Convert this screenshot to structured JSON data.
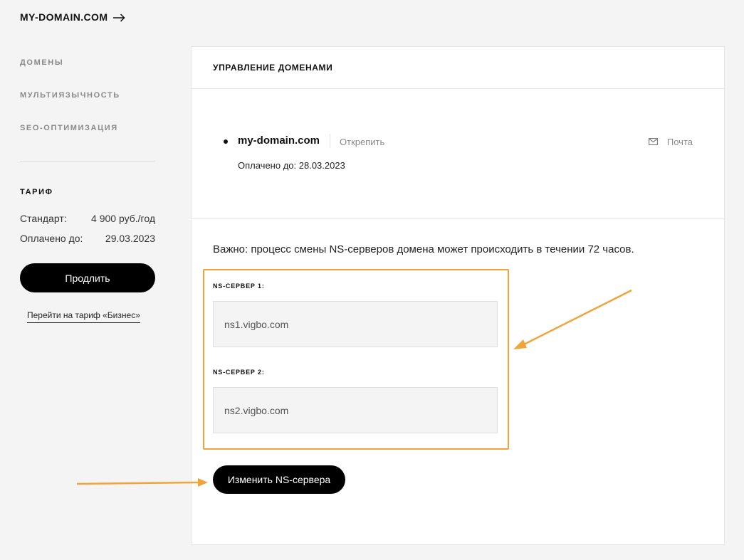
{
  "header": {
    "site_link_label": "MY-DOMAIN.COM",
    "site_link_icon": "arrow-right-icon"
  },
  "sidebar": {
    "nav_items": [
      {
        "label": "ДОМЕНЫ"
      },
      {
        "label": "МУЛЬТИЯЗЫЧНОСТЬ"
      },
      {
        "label": "SEO-ОПТИМИЗАЦИЯ"
      }
    ],
    "tariff": {
      "title": "ТАРИФ",
      "plan_label": "Стандарт:",
      "plan_price": "4 900 руб./год",
      "paid_label": "Оплачено до:",
      "paid_date": "29.03.2023",
      "renew_button": "Продлить",
      "switch_link": "Перейти на тариф «Бизнес»"
    }
  },
  "main": {
    "title": "УПРАВЛЕНИЕ ДОМЕНАМИ",
    "domain": {
      "name": "my-domain.com",
      "unpin_label": "Открепить",
      "mail_label": "Почта",
      "mail_icon": "envelope-icon",
      "paid_until": "Оплачено до: 28.03.2023"
    },
    "ns": {
      "warning": "Важно: процесс смены NS-серверов домена может происходить в течении 72 часов.",
      "server1_label": "NS-СЕРВЕР 1:",
      "server1_value": "ns1.vigbo.com",
      "server2_label": "NS-СЕРВЕР 2:",
      "server2_value": "ns2.vigbo.com",
      "change_button": "Изменить NS-сервера"
    }
  },
  "colors": {
    "accent_annotation": "#f0a53a",
    "button_bg": "#000000",
    "page_bg": "#f4f4f4"
  }
}
